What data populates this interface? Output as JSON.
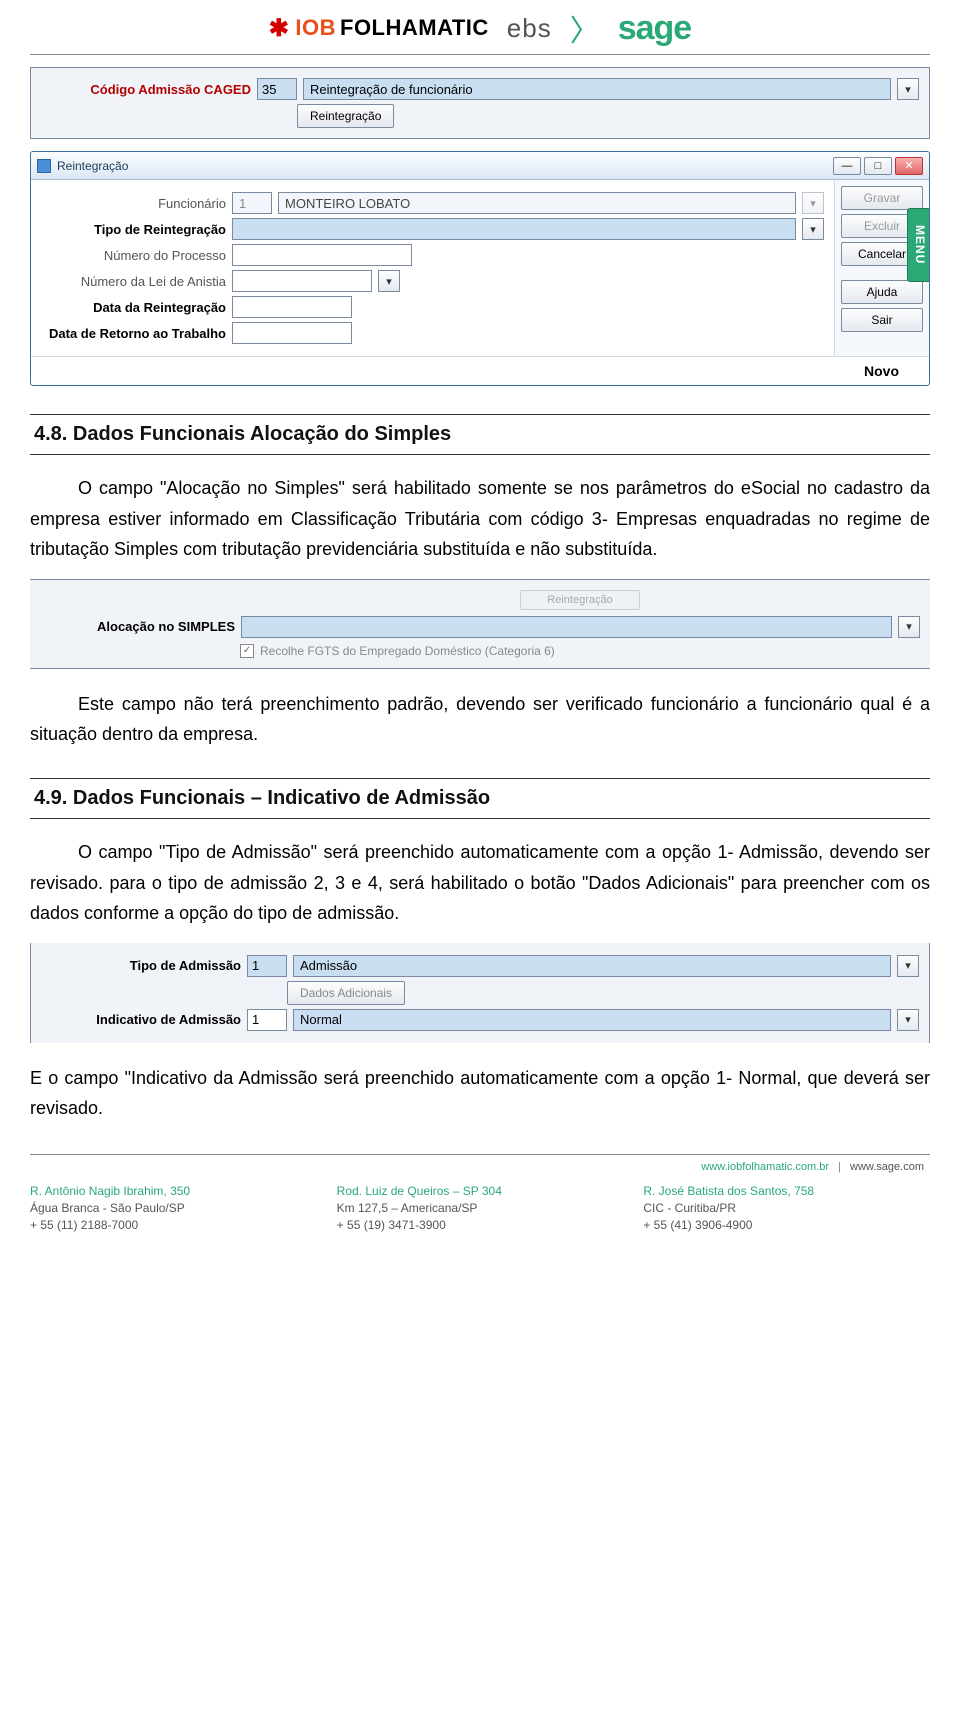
{
  "header": {
    "iob_prefix": "IOB",
    "iob_suffix": "FOLHAMATIC",
    "ebs": "ebs",
    "sage": "sage"
  },
  "ui_caged": {
    "label": "Código Admissão CAGED",
    "code": "35",
    "desc": "Reintegração de funcionário",
    "button": "Reintegração"
  },
  "win_reint": {
    "title": "Reintegração",
    "menu_tab": "MENU",
    "fields": {
      "funcionario_label": "Funcionário",
      "funcionario_code": "1",
      "funcionario_nome": "MONTEIRO LOBATO",
      "tipo_label": "Tipo de Reintegração",
      "num_processo_label": "Número do Processo",
      "num_anistia_label": "Número da Lei de Anistia",
      "data_reint_label": "Data da Reintegração",
      "data_retorno_label": "Data de Retorno ao Trabalho"
    },
    "buttons": {
      "gravar": "Gravar",
      "excluir": "Excluir",
      "cancelar": "Cancelar",
      "ajuda": "Ajuda",
      "sair": "Sair",
      "novo": "Novo"
    }
  },
  "section_48": {
    "heading": "4.8. Dados Funcionais Alocação do Simples",
    "p1": "O campo \"Alocação no Simples\" será habilitado somente se nos parâmetros do eSocial no cadastro da empresa estiver informado em Classificação Tributária com código 3- Empresas enquadradas no regime de tributação Simples com tributação previdenciária substituída e não substituída.",
    "p2": "Este campo não terá preenchimento padrão, devendo ser verificado funcionário a funcionário qual é a situação dentro da empresa."
  },
  "ui_simples": {
    "ghost_btn": "Reintegração",
    "label": "Alocação no SIMPLES",
    "checkbox_text": "Recolhe FGTS do Empregado Doméstico (Categoria 6)"
  },
  "section_49": {
    "heading": "4.9. Dados Funcionais – Indicativo de Admissão",
    "p1": "O campo \"Tipo de Admissão\" será preenchido automaticamente com a opção 1- Admissão, devendo ser revisado. para o tipo de admissão 2, 3 e 4, será habilitado o botão \"Dados Adicionais\" para preencher com os dados conforme a opção do tipo de admissão.",
    "p2": "E o campo \"Indicativo da Admissão será preenchido automaticamente com a opção 1- Normal, que deverá ser revisado."
  },
  "ui_admissao": {
    "tipo_label": "Tipo de Admissão",
    "tipo_code": "1",
    "tipo_desc": "Admissão",
    "dados_btn": "Dados Adicionais",
    "indicativo_label": "Indicativo de Admissão",
    "indicativo_code": "1",
    "indicativo_desc": "Normal"
  },
  "footer": {
    "link1": "www.iobfolhamatic.com.br",
    "link2": "www.sage.com",
    "col1": {
      "l1": "R. Antônio Nagib Ibrahim, 350",
      "l2": "Água Branca - São Paulo/SP",
      "l3": "+ 55 (11) 2188-7000"
    },
    "col2": {
      "l1": "Rod. Luiz de Queiros – SP 304",
      "l2": "Km 127,5 – Americana/SP",
      "l3": "+ 55 (19) 3471-3900"
    },
    "col3": {
      "l1": "R. José Batista dos Santos, 758",
      "l2": "CIC - Curitiba/PR",
      "l3": "+ 55 (41) 3906-4900"
    }
  }
}
